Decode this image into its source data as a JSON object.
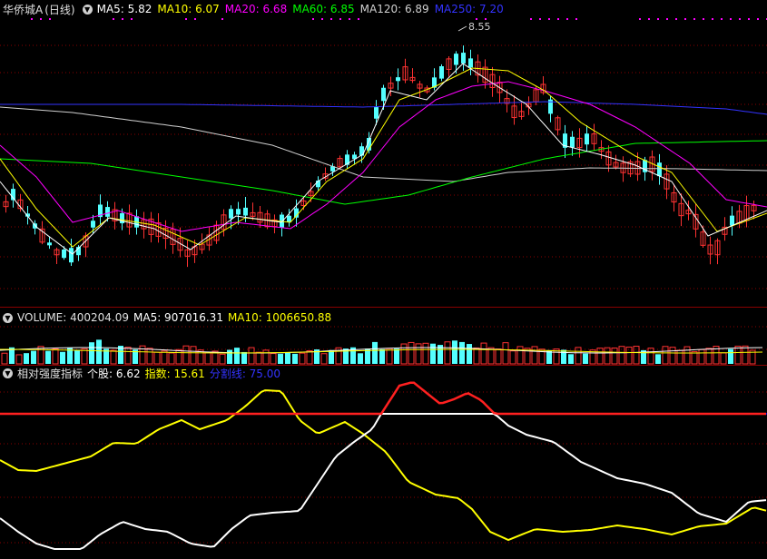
{
  "price_panel": {
    "stock_name": "华侨城A",
    "period": "(日线)",
    "ma_labels": [
      {
        "text": "MA5: 5.82",
        "color": "#ffffff"
      },
      {
        "text": "MA10: 6.07",
        "color": "#ffff00"
      },
      {
        "text": "MA20: 6.68",
        "color": "#ff00ff"
      },
      {
        "text": "MA60: 6.85",
        "color": "#00ff00"
      },
      {
        "text": "MA120: 6.89",
        "color": "#d0d0d0"
      },
      {
        "text": "MA250: 7.20",
        "color": "#3333ff"
      }
    ],
    "high_marker": "8.55"
  },
  "volume_panel": {
    "title": "VOLUME: 400204.09",
    "ma5": "MA5: 907016.31",
    "ma10": "MA10: 1006650.88"
  },
  "indicator_panel": {
    "title": "相对强度指标",
    "stock_label": "个股: 6.62",
    "index_label": "指数: 15.61",
    "split_label": "分割线: 75.00"
  },
  "colors": {
    "up": "#ff3232",
    "down": "#54ffff",
    "grid": "#8a0000",
    "ma5": "#ffffff",
    "ma10": "#ffff00",
    "ma20": "#ff00ff",
    "ma60": "#00ff00",
    "ma120": "#d0d0d0",
    "ma250": "#3333ff",
    "split_line": "#0000ff"
  },
  "icons": {
    "toggle": "chevron-down-icon"
  }
}
